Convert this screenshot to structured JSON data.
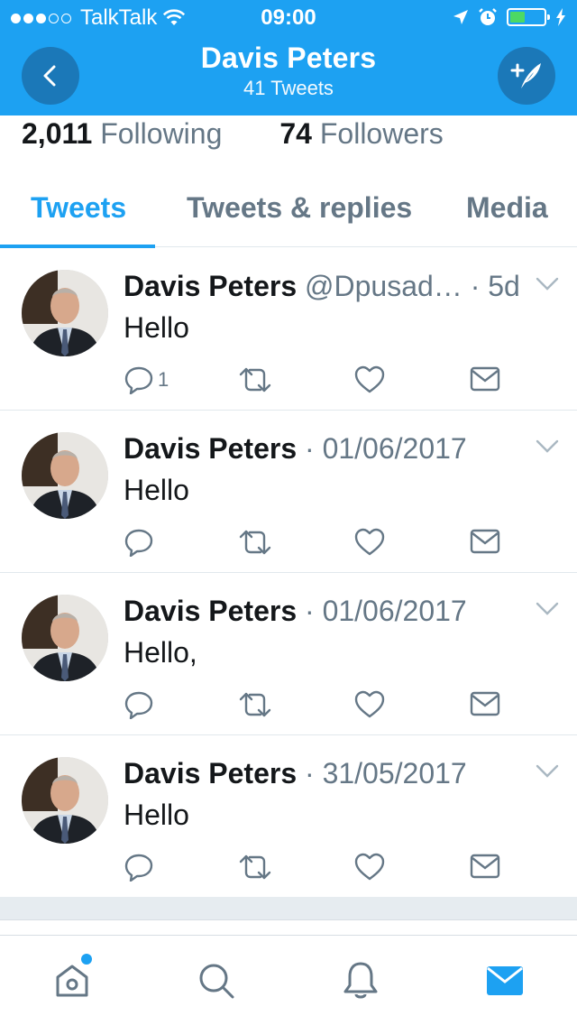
{
  "status_bar": {
    "carrier": "TalkTalk",
    "time": "09:00",
    "signal_dots_filled": 3,
    "signal_dots_total": 5,
    "battery_level": 0.45
  },
  "header": {
    "title": "Davis Peters",
    "subtitle": "41 Tweets",
    "back_icon": "chevron-left-icon",
    "compose_icon": "compose-tweet-icon"
  },
  "stats": {
    "following_count": "2,011",
    "following_label": "Following",
    "followers_count": "74",
    "followers_label": "Followers"
  },
  "tabs": [
    {
      "label": "Tweets",
      "active": true
    },
    {
      "label": "Tweets & replies",
      "active": false
    },
    {
      "label": "Media",
      "active": false
    }
  ],
  "tweets": [
    {
      "name": "Davis Peters",
      "meta": "@Dpusad… · 5d",
      "text": "Hello",
      "reply_count": "1"
    },
    {
      "name": "Davis Peters",
      "meta": "· 01/06/2017",
      "text": "Hello",
      "reply_count": ""
    },
    {
      "name": "Davis Peters",
      "meta": "· 01/06/2017",
      "text": "Hello,",
      "reply_count": ""
    },
    {
      "name": "Davis Peters",
      "meta": "· 31/05/2017",
      "text": "Hello",
      "reply_count": ""
    }
  ],
  "tabbar": {
    "items": [
      "home-icon",
      "search-icon",
      "notifications-icon",
      "messages-icon"
    ],
    "active": "messages-icon"
  },
  "colors": {
    "brand": "#1da1f2",
    "header_button": "#1b78b8",
    "text_secondary": "#657786",
    "battery_fill": "#4cd964"
  }
}
